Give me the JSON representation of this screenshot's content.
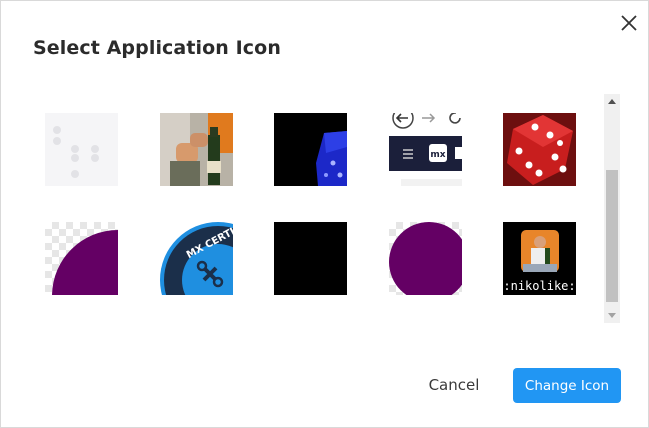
{
  "dialog": {
    "title": "Select Application Icon",
    "cancel_label": "Cancel",
    "change_label": "Change Icon",
    "accent_color": "#2196f3"
  },
  "icons": [
    {
      "name": "dots-placeholder"
    },
    {
      "name": "person-with-bottle"
    },
    {
      "name": "blue-dice-dark"
    },
    {
      "name": "browser-toolbar-mx",
      "badge": "mx"
    },
    {
      "name": "red-dice"
    },
    {
      "name": "purple-quarter-circle"
    },
    {
      "name": "mx-certified-badge",
      "label": "MX CERTI"
    },
    {
      "name": "black-square"
    },
    {
      "name": "purple-circle"
    },
    {
      "name": "nikolike-emoji",
      "caption": ":nikolike:"
    }
  ]
}
